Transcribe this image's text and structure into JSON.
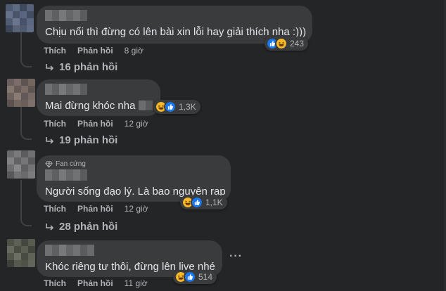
{
  "ui": {
    "like_label": "Thích",
    "reply_label": "Phản hồi"
  },
  "comments": [
    {
      "badge": "",
      "text": "Chịu nổi thì đừng có lên bài xin lỗi hay giải thích nha :)))",
      "time": "8 giờ",
      "reaction_count": "243",
      "reactions": [
        "like-icon",
        "haha-icon"
      ],
      "replies": "16 phản hồi"
    },
    {
      "badge": "",
      "text": "Mai đừng khóc nha ",
      "time": "12 giờ",
      "reaction_count": "1,3K",
      "reactions": [
        "haha-icon",
        "like-icon"
      ],
      "replies": "19 phản hồi"
    },
    {
      "badge": "Fan cứng",
      "text": "Người sống đạo lý. Là bao nguyên rạp",
      "time": "12 giờ",
      "reaction_count": "1,1K",
      "reactions": [
        "haha-icon",
        "like-icon"
      ],
      "replies": "28 phản hồi"
    },
    {
      "badge": "",
      "text": "Khóc riêng tư thôi, đừng lên live nhé",
      "time": "11 giờ",
      "reaction_count": "514",
      "reactions": [
        "haha-icon",
        "like-icon"
      ],
      "replies": ""
    }
  ],
  "colors": {
    "background": "#242526",
    "bubble": "#3a3b3c",
    "text_primary": "#e4e6eb",
    "text_secondary": "#b0b3b8",
    "like_blue": "#1877f2",
    "haha_yellow": "#f7b928"
  }
}
